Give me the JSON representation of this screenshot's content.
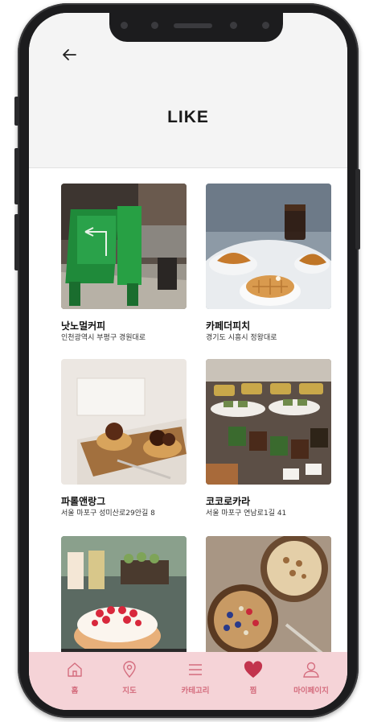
{
  "header": {
    "back_icon": "arrow-left-icon",
    "title": "LIKE"
  },
  "cards": [
    {
      "name": "낫노멀커피",
      "address": "인천광역시 부평구 경원대로"
    },
    {
      "name": "카페더피치",
      "address": "경기도 시흥시 정왕대로"
    },
    {
      "name": "파롤앤랑그",
      "address": "서울 마포구 성미산로29안길 8"
    },
    {
      "name": "코코로카라",
      "address": "서울 마포구 연남로1길 41"
    },
    {
      "name": "",
      "address": ""
    },
    {
      "name": "",
      "address": ""
    }
  ],
  "tabs": [
    {
      "label": "홈",
      "icon": "home-icon"
    },
    {
      "label": "지도",
      "icon": "map-pin-icon"
    },
    {
      "label": "카테고리",
      "icon": "menu-icon"
    },
    {
      "label": "찜",
      "icon": "heart-icon",
      "active": true
    },
    {
      "label": "마이페이지",
      "icon": "user-icon"
    }
  ],
  "colors": {
    "tab_bar": "#f5d3d7",
    "tab_icon": "#d46d7e",
    "active_heart": "#c2344d"
  }
}
